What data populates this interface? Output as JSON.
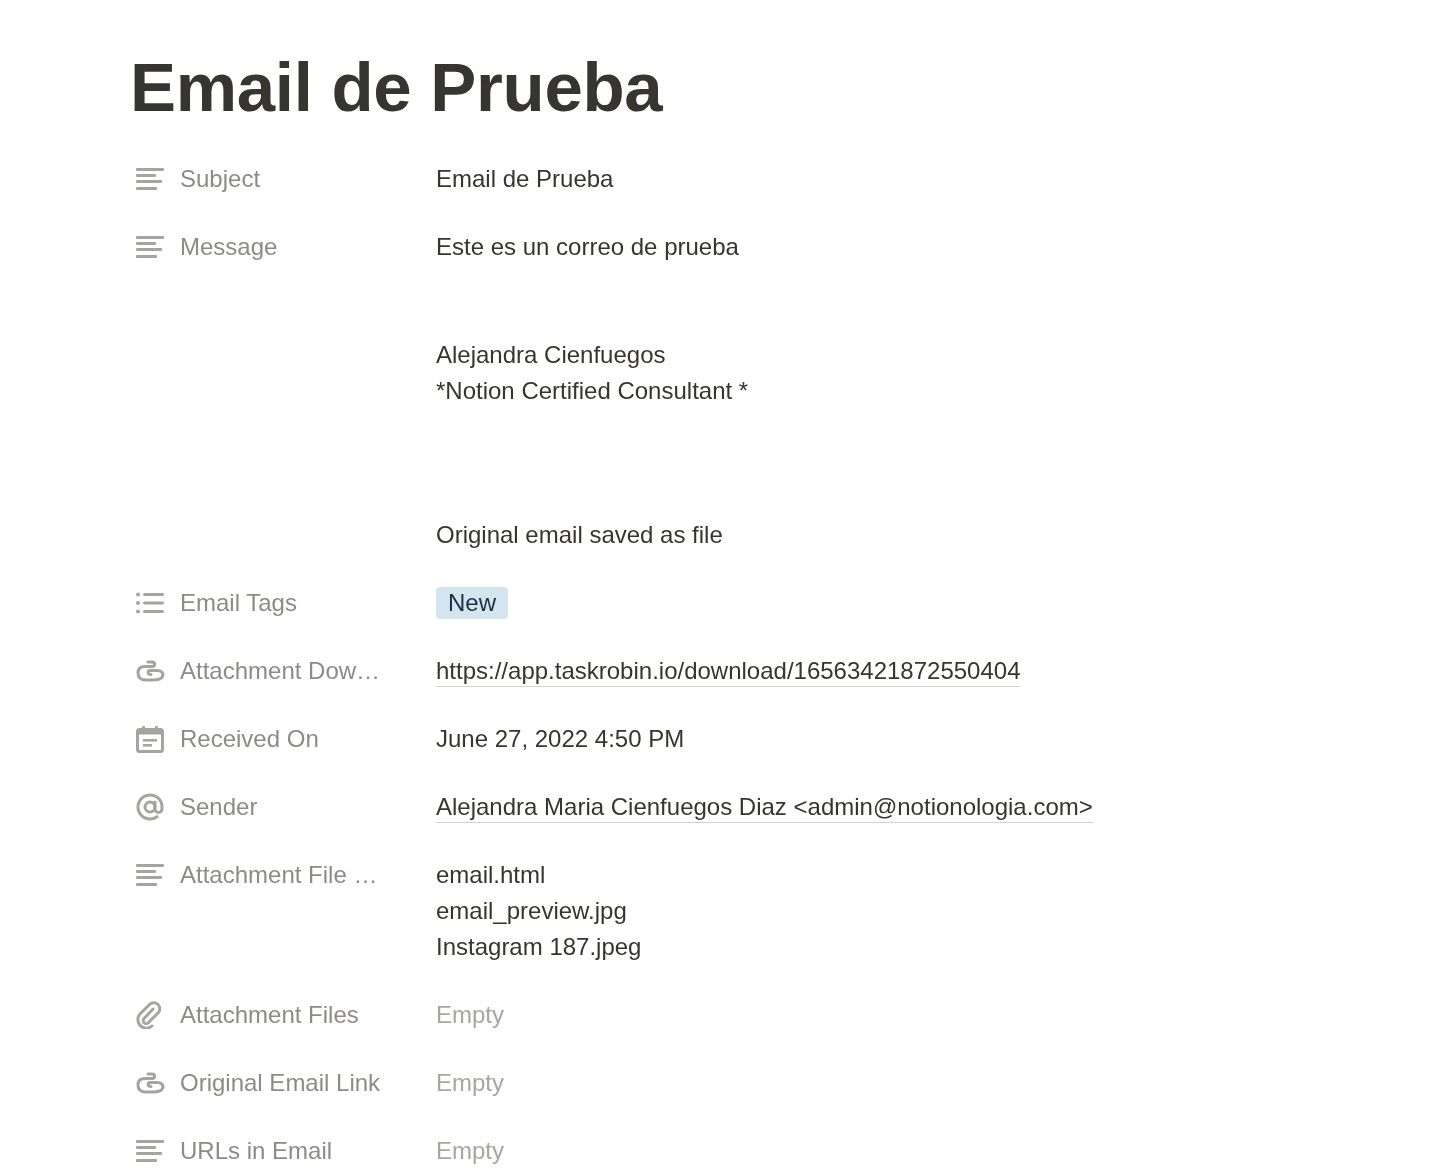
{
  "page": {
    "title": "Email de Prueba"
  },
  "properties": [
    {
      "kind": "text",
      "label": "Subject",
      "value": "Email de Prueba"
    },
    {
      "kind": "text",
      "label": "Message",
      "value": "Este es un correo de prueba\n\n\nAlejandra Cienfuegos\n*Notion Certified Consultant *\n\n\n\nOriginal email saved as file"
    },
    {
      "kind": "tags",
      "label": "Email Tags",
      "tags": [
        {
          "label": "New",
          "color": "#d3e5ef"
        }
      ]
    },
    {
      "kind": "url",
      "label": "Attachment Dow…",
      "value": "https://app.taskrobin.io/download/16563421872550404"
    },
    {
      "kind": "date",
      "label": "Received On",
      "value": "June 27, 2022 4:50 PM"
    },
    {
      "kind": "email",
      "label": "Sender",
      "value": "Alejandra Maria Cienfuegos Diaz <admin@notionologia.com>"
    },
    {
      "kind": "text",
      "label": "Attachment File …",
      "value": "email.html\nemail_preview.jpg\nInstagram 187.jpeg"
    },
    {
      "kind": "files",
      "label": "Attachment Files",
      "placeholder": "Empty"
    },
    {
      "kind": "url",
      "label": "Original Email Link",
      "placeholder": "Empty"
    },
    {
      "kind": "text",
      "label": "URLs in Email",
      "placeholder": "Empty"
    }
  ]
}
